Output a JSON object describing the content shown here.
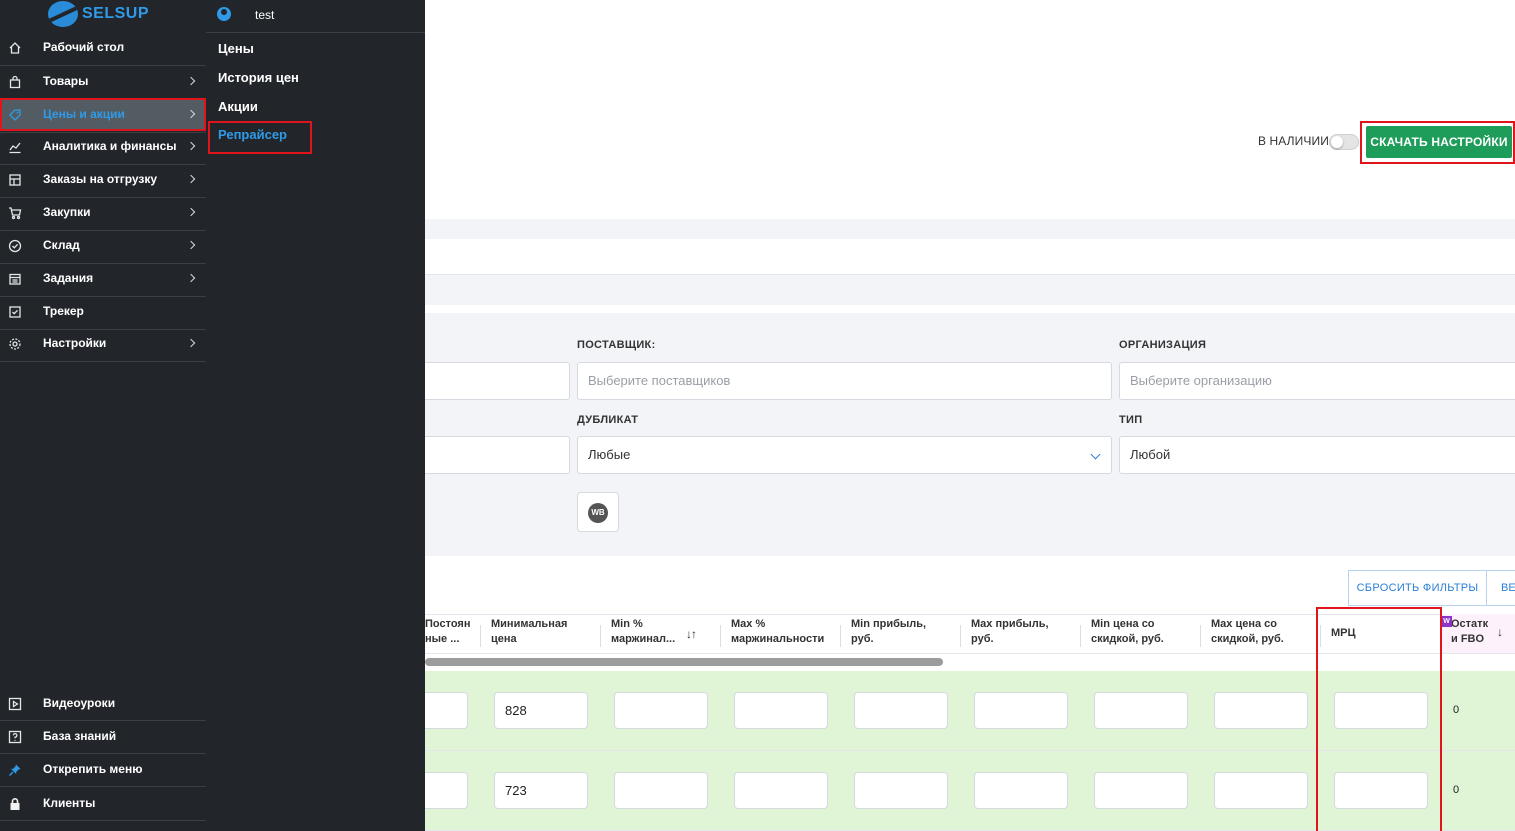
{
  "app": {
    "brand": "SELSUP",
    "brand_color": "#2f9be8"
  },
  "toolbar": {
    "in_stock_label": "В НАЛИЧИИ",
    "in_stock_enabled": false,
    "download_settings_label": "СКАЧАТЬ НАСТРОЙКИ",
    "download_color": "#1e9d5a"
  },
  "filters": {
    "supplier": {
      "label": "ПОСТАВЩИК:",
      "placeholder": "Выберите поставщиков"
    },
    "organization": {
      "label": "ОРГАНИЗАЦИЯ",
      "placeholder": "Выберите организацию"
    },
    "duplicate": {
      "label": "ДУБЛИКАТ",
      "value": "Любые"
    },
    "type": {
      "label": "ТИП",
      "value": "Любой"
    },
    "marketplace_badge": "WB",
    "reset_label": "СБРОСИТЬ ФИЛЬТРЫ",
    "next_label": "ВЕ"
  },
  "table": {
    "columns": [
      {
        "line1": "Постоян",
        "line2": "ные ..."
      },
      {
        "line1": "Минимальная",
        "line2": "цена"
      },
      {
        "line1": "Min %",
        "line2": "маржинал..."
      },
      {
        "line1": "Max %",
        "line2": "маржинальности"
      },
      {
        "line1": "Min прибыль,",
        "line2": "руб."
      },
      {
        "line1": "Max прибыль,",
        "line2": "руб."
      },
      {
        "line1": "Min цена со",
        "line2": "скидкой, руб."
      },
      {
        "line1": "Max цена со",
        "line2": "скидкой, руб."
      },
      {
        "line1": "МРЦ",
        "line2": ""
      },
      {
        "line1": "Остатк",
        "line2": "и FBO"
      }
    ],
    "sort_icon": "↓↑",
    "sort_desc_icon": "↓",
    "ozon_badge": "W",
    "rows": [
      {
        "min_price": "828",
        "fbo_stock": "0"
      },
      {
        "min_price": "723",
        "fbo_stock": "0"
      }
    ],
    "row_highlight_color": "#dff5d6"
  },
  "sidebar": {
    "items": [
      {
        "label": "Рабочий стол",
        "icon": "home-icon"
      },
      {
        "label": "Товары",
        "icon": "bag-icon"
      },
      {
        "label": "Цены и акции",
        "icon": "tag-icon"
      },
      {
        "label": "Аналитика и финансы",
        "icon": "chart-icon"
      },
      {
        "label": "Заказы на отгрузку",
        "icon": "box-icon"
      },
      {
        "label": "Закупки",
        "icon": "cart-icon"
      },
      {
        "label": "Склад",
        "icon": "check-circle-icon"
      },
      {
        "label": "Задания",
        "icon": "calendar-icon"
      },
      {
        "label": "Трекер",
        "icon": "checklist-icon"
      },
      {
        "label": "Настройки",
        "icon": "gear-icon"
      }
    ],
    "bottom_items": [
      {
        "label": "Видеоуроки",
        "icon": "play-icon"
      },
      {
        "label": "База знаний",
        "icon": "question-icon"
      },
      {
        "label": "Открепить меню",
        "icon": "pin-icon"
      },
      {
        "label": "Клиенты",
        "icon": "lock-icon"
      }
    ]
  },
  "flyout": {
    "user": "test",
    "items": [
      "Цены",
      "История цен",
      "Акции",
      "Репрайсер"
    ]
  },
  "highlight_color": "#e0141b"
}
